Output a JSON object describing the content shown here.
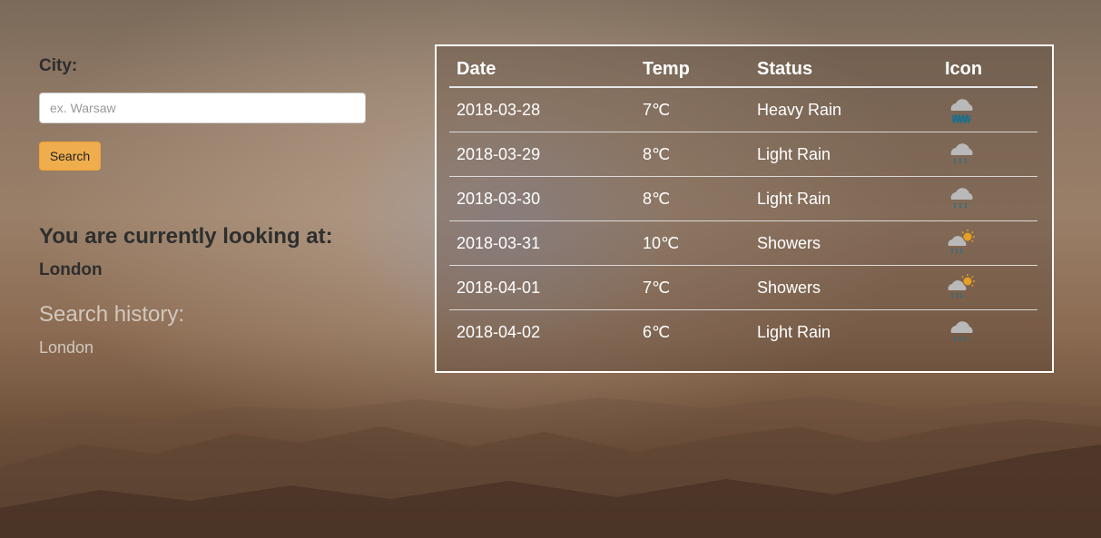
{
  "search": {
    "city_label": "City:",
    "placeholder": "ex. Warsaw",
    "value": "",
    "button_label": "Search"
  },
  "current": {
    "heading": "You are currently looking at:",
    "city": "London"
  },
  "history": {
    "heading": "Search history:",
    "items": [
      "London"
    ]
  },
  "forecast": {
    "headers": {
      "date": "Date",
      "temp": "Temp",
      "status": "Status",
      "icon": "Icon"
    },
    "rows": [
      {
        "date": "2018-03-28",
        "temp": "7℃",
        "status": "Heavy Rain",
        "icon": "heavy-rain-icon"
      },
      {
        "date": "2018-03-29",
        "temp": "8℃",
        "status": "Light Rain",
        "icon": "light-rain-icon"
      },
      {
        "date": "2018-03-30",
        "temp": "8℃",
        "status": "Light Rain",
        "icon": "light-rain-icon"
      },
      {
        "date": "2018-03-31",
        "temp": "10℃",
        "status": "Showers",
        "icon": "showers-icon"
      },
      {
        "date": "2018-04-01",
        "temp": "7℃",
        "status": "Showers",
        "icon": "showers-icon"
      },
      {
        "date": "2018-04-02",
        "temp": "6℃",
        "status": "Light Rain",
        "icon": "light-rain-icon"
      }
    ]
  },
  "colors": {
    "button": "#f0ad4e",
    "cloud": "#b9b9b9",
    "rain": "#1f6f8b",
    "sun": "#e6a023"
  }
}
